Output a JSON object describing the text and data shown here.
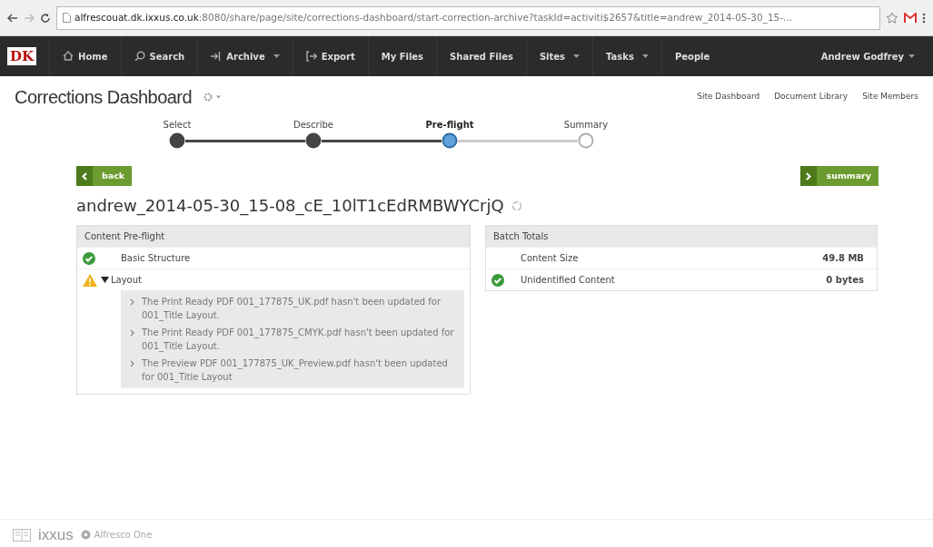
{
  "browser": {
    "url_host": "alfrescouat.dk.ixxus.co.uk",
    "url_rest": ":8080/share/page/site/corrections-dashboard/start-correction-archive?taskId=activiti$2657&title=andrew_2014-05-30_15-..."
  },
  "navbar": {
    "logo": "DK",
    "items": [
      {
        "label": "Home",
        "kind": "home",
        "dropdown": false
      },
      {
        "label": "Search",
        "kind": "search",
        "dropdown": false
      },
      {
        "label": "Archive",
        "kind": "archive",
        "dropdown": true
      },
      {
        "label": "Export",
        "kind": "export",
        "dropdown": false
      },
      {
        "label": "My Files",
        "kind": "plain",
        "dropdown": false
      },
      {
        "label": "Shared Files",
        "kind": "plain",
        "dropdown": false
      },
      {
        "label": "Sites",
        "kind": "plain",
        "dropdown": true
      },
      {
        "label": "Tasks",
        "kind": "plain",
        "dropdown": true
      },
      {
        "label": "People",
        "kind": "plain",
        "dropdown": false
      }
    ],
    "user": "Andrew Godfrey"
  },
  "site": {
    "title": "Corrections Dashboard",
    "links": [
      "Site Dashboard",
      "Document Library",
      "Site Members"
    ]
  },
  "steps": [
    {
      "label": "Select",
      "done": true,
      "selected": false
    },
    {
      "label": "Describe",
      "done": true,
      "selected": false
    },
    {
      "label": "Pre-flight",
      "done": false,
      "selected": true
    },
    {
      "label": "Summary",
      "done": false,
      "selected": false
    }
  ],
  "back_button": "back",
  "next_button": "summary",
  "batch_name": "andrew_2014-05-30_15-08_cE_10lT1cEdRMBWYCrjQ",
  "preflight": {
    "title": "Content Pre-flight",
    "checks": [
      {
        "label": "Basic Structure",
        "kind": "ok",
        "expanded": false
      },
      {
        "label": "Layout",
        "kind": "warning",
        "expanded": true,
        "messages": [
          "The Print Ready PDF 001_177875_UK.pdf hasn't been updated for 001_Title Layout.",
          "The Print Ready PDF 001_177875_CMYK.pdf hasn't been updated for 001_Title Layout.",
          "The Preview PDF 001_177875_UK_Preview.pdf hasn't been updated for 001_Title Layout"
        ]
      }
    ]
  },
  "totals": {
    "title": "Batch Totals",
    "rows": [
      {
        "label": "Content Size",
        "value": "49.8 MB",
        "kind": "plain"
      },
      {
        "label": "Unidentified Content",
        "value": "0 bytes",
        "kind": "ok"
      }
    ]
  },
  "footer": {
    "brand": "ixxus",
    "product": "Alfresco One"
  }
}
